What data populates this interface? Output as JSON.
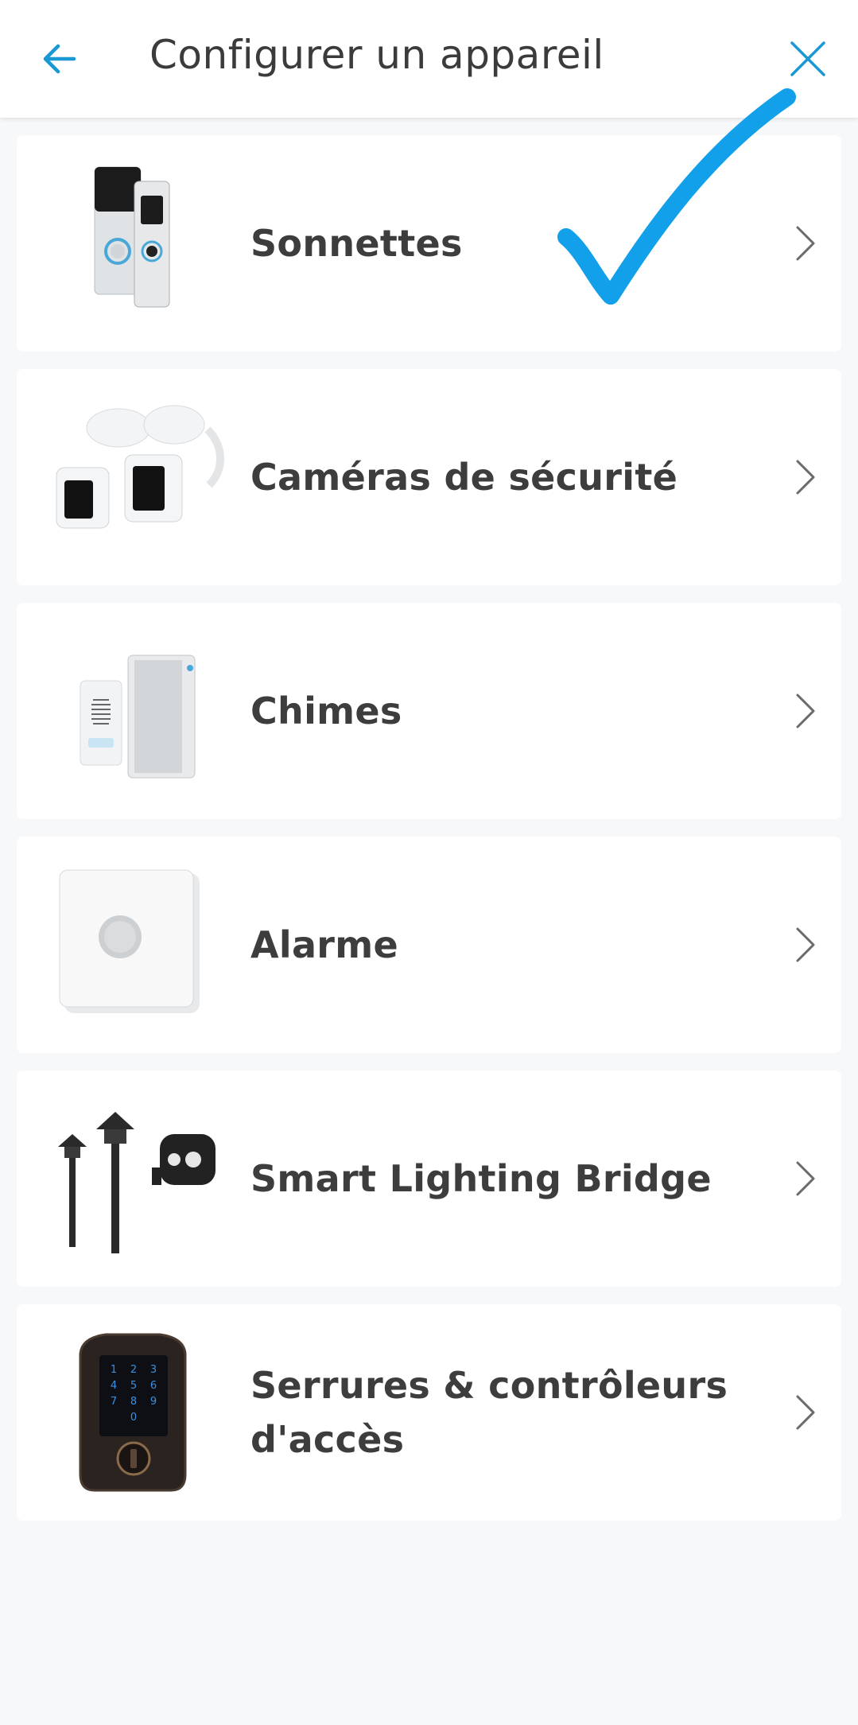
{
  "header": {
    "title": "Configurer un appareil",
    "back_icon": "arrow-left-icon",
    "close_icon": "close-icon",
    "accent_color": "#1998d5"
  },
  "devices": [
    {
      "label": "Sonnettes",
      "icon": "doorbell-image"
    },
    {
      "label": "Caméras de sécurité",
      "icon": "security-camera-image"
    },
    {
      "label": "Chimes",
      "icon": "chime-image"
    },
    {
      "label": "Alarme",
      "icon": "alarm-image"
    },
    {
      "label": "Smart Lighting Bridge",
      "icon": "smart-lighting-image"
    },
    {
      "label": "Serrures & contrôleurs d'accès",
      "icon": "smart-lock-image"
    }
  ],
  "annotation": {
    "icon": "blue-checkmark-overlay",
    "color": "#12a0ea"
  },
  "colors": {
    "background": "#f7f8fa",
    "card": "#ffffff",
    "text": "#3d3d3d",
    "chevron": "#6b6b6b"
  }
}
